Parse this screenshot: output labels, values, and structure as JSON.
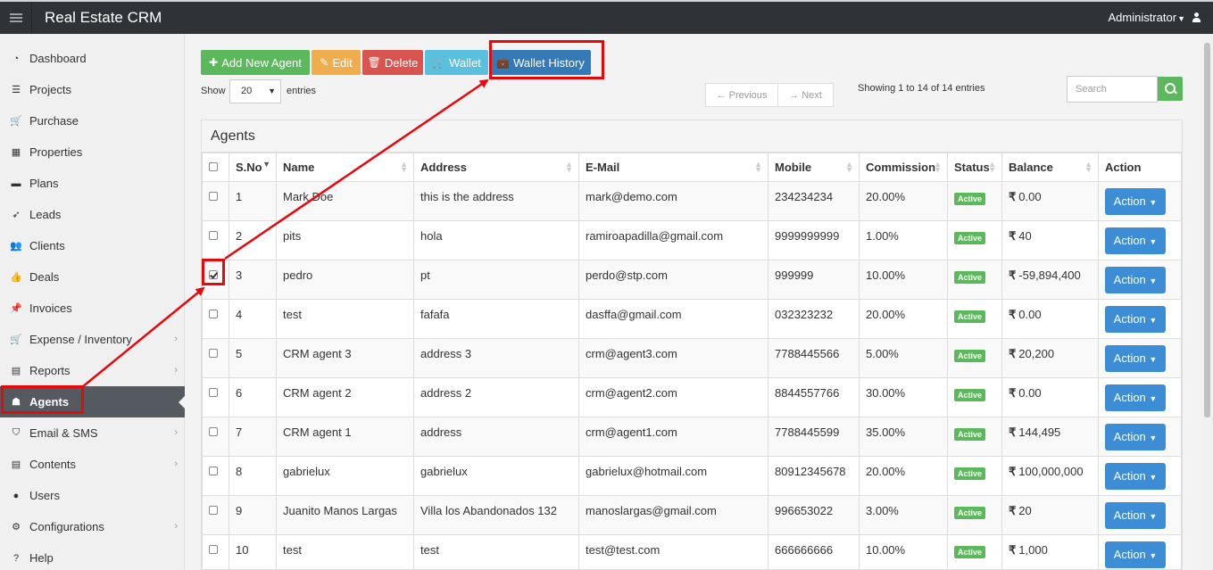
{
  "topbar": {
    "title": "Real Estate CRM",
    "user": "Administrator"
  },
  "sidebar": {
    "items": [
      {
        "label": "Dashboard",
        "icon": "tachometer-icon"
      },
      {
        "label": "Projects",
        "icon": "server-icon"
      },
      {
        "label": "Purchase",
        "icon": "cart-icon"
      },
      {
        "label": "Properties",
        "icon": "building-icon"
      },
      {
        "label": "Plans",
        "icon": "briefcase-icon"
      },
      {
        "label": "Leads",
        "icon": "rocket-icon"
      },
      {
        "label": "Clients",
        "icon": "users-icon"
      },
      {
        "label": "Deals",
        "icon": "thumbs-up-icon"
      },
      {
        "label": "Invoices",
        "icon": "thumbtack-icon"
      },
      {
        "label": "Expense / Inventory",
        "icon": "cart-icon"
      },
      {
        "label": "Reports",
        "icon": "table-icon"
      },
      {
        "label": "Agents",
        "icon": "user-secret-icon"
      },
      {
        "label": "Email & SMS",
        "icon": "shield-icon"
      },
      {
        "label": "Contents",
        "icon": "list-alt-icon"
      },
      {
        "label": "Users",
        "icon": "user-icon"
      },
      {
        "label": "Configurations",
        "icon": "cogs-icon"
      },
      {
        "label": "Help",
        "icon": "question-icon"
      }
    ],
    "active": "Agents"
  },
  "toolbar": {
    "add": "Add New Agent",
    "edit": "Edit",
    "delete": "Delete",
    "wallet": "Wallet",
    "wallet_history": "Wallet History"
  },
  "listing": {
    "show": "Show",
    "page_length": "20",
    "entries": "entries",
    "previous": "← Previous",
    "next": "→ Next",
    "showing": "Showing 1 to 14 of 14 entries",
    "search_placeholder": "Search"
  },
  "colors": {
    "green": "#5cb85c",
    "orange": "#f0ad4e",
    "red": "#d9534f",
    "teal": "#5bc0de",
    "blue": "#337ab7",
    "highlight": "#e8080c"
  },
  "table": {
    "title": "Agents",
    "columns": [
      "S.No",
      "Name",
      "Address",
      "E-Mail",
      "Mobile",
      "Commission",
      "Status",
      "Balance",
      "Action"
    ],
    "rows": [
      {
        "sno": "1",
        "name": "Mark Doe",
        "address": "this is the address",
        "email": "mark@demo.com",
        "mobile": "234234234",
        "commission": "20.00%",
        "status": "Active",
        "balance": "0.00",
        "checked": false
      },
      {
        "sno": "2",
        "name": "pits",
        "address": "hola",
        "email": "ramiroapadilla@gmail.com",
        "mobile": "9999999999",
        "commission": "1.00%",
        "status": "Active",
        "balance": "40",
        "checked": false
      },
      {
        "sno": "3",
        "name": "pedro",
        "address": "pt",
        "email": "perdo@stp.com",
        "mobile": "999999",
        "commission": "10.00%",
        "status": "Active",
        "balance": "-59,894,400",
        "checked": true
      },
      {
        "sno": "4",
        "name": "test",
        "address": "fafafa",
        "email": "dasffa@gmail.com",
        "mobile": "032323232",
        "commission": "20.00%",
        "status": "Active",
        "balance": "0.00",
        "checked": false
      },
      {
        "sno": "5",
        "name": "CRM agent 3",
        "address": "address 3",
        "email": "crm@agent3.com",
        "mobile": "7788445566",
        "commission": "5.00%",
        "status": "Active",
        "balance": "20,200",
        "checked": false
      },
      {
        "sno": "6",
        "name": "CRM agent 2",
        "address": "address 2",
        "email": "crm@agent2.com",
        "mobile": "8844557766",
        "commission": "30.00%",
        "status": "Active",
        "balance": "0.00",
        "checked": false
      },
      {
        "sno": "7",
        "name": "CRM agent 1",
        "address": "address",
        "email": "crm@agent1.com",
        "mobile": "7788445599",
        "commission": "35.00%",
        "status": "Active",
        "balance": "144,495",
        "checked": false
      },
      {
        "sno": "8",
        "name": "gabrielux",
        "address": "gabrielux",
        "email": "gabrielux@hotmail.com",
        "mobile": "80912345678",
        "commission": "20.00%",
        "status": "Active",
        "balance": "100,000,000",
        "checked": false
      },
      {
        "sno": "9",
        "name": "Juanito Manos Largas",
        "address": "Villa los Abandonados 132",
        "email": "manoslargas@gmail.com",
        "mobile": "996653022",
        "commission": "3.00%",
        "status": "Active",
        "balance": "20",
        "checked": false
      },
      {
        "sno": "10",
        "name": "test",
        "address": "test",
        "email": "test@test.com",
        "mobile": "666666666",
        "commission": "10.00%",
        "status": "Active",
        "balance": "1,000",
        "checked": false
      }
    ],
    "action_label": "Action",
    "currency": "₹"
  }
}
